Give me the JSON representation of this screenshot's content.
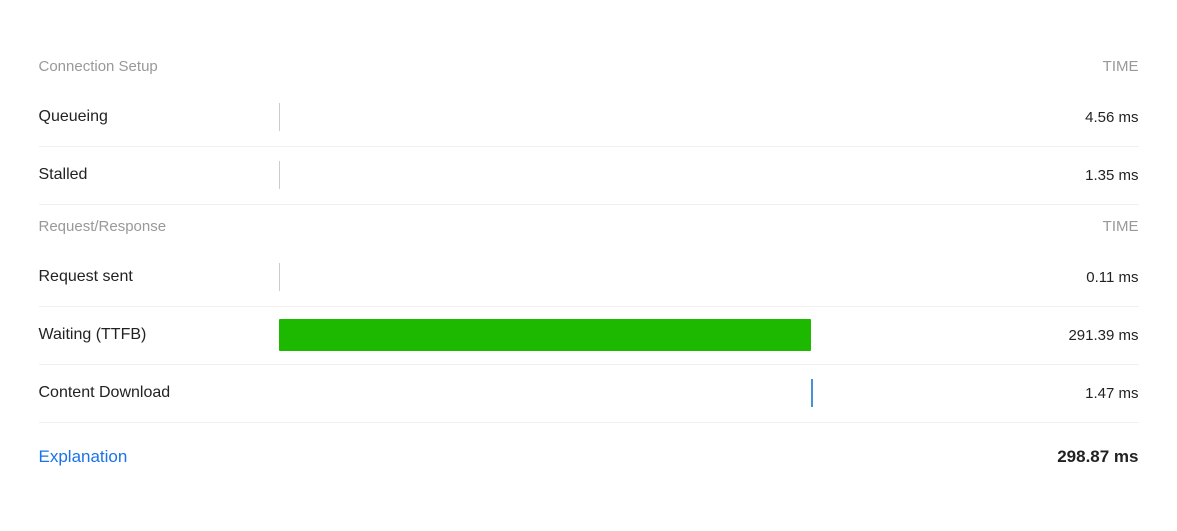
{
  "sections": [
    {
      "type": "header",
      "label": "Connection Setup",
      "time_label": "TIME"
    },
    {
      "type": "row",
      "label": "Queueing",
      "bar": "tick",
      "bar_color": "gray",
      "time": "4.56 ms"
    },
    {
      "type": "row",
      "label": "Stalled",
      "bar": "tick",
      "bar_color": "gray",
      "time": "1.35 ms"
    },
    {
      "type": "header",
      "label": "Request/Response",
      "time_label": "TIME"
    },
    {
      "type": "row",
      "label": "Request sent",
      "bar": "tick",
      "bar_color": "gray",
      "time": "0.11 ms"
    },
    {
      "type": "row",
      "label": "Waiting (TTFB)",
      "bar": "block",
      "bar_color": "green",
      "bar_width_pct": 72,
      "time": "291.39 ms"
    },
    {
      "type": "row",
      "label": "Content Download",
      "bar": "tick",
      "bar_color": "blue",
      "bar_position_pct": 72,
      "time": "1.47 ms"
    }
  ],
  "footer": {
    "explanation_label": "Explanation",
    "total_time": "298.87 ms"
  }
}
